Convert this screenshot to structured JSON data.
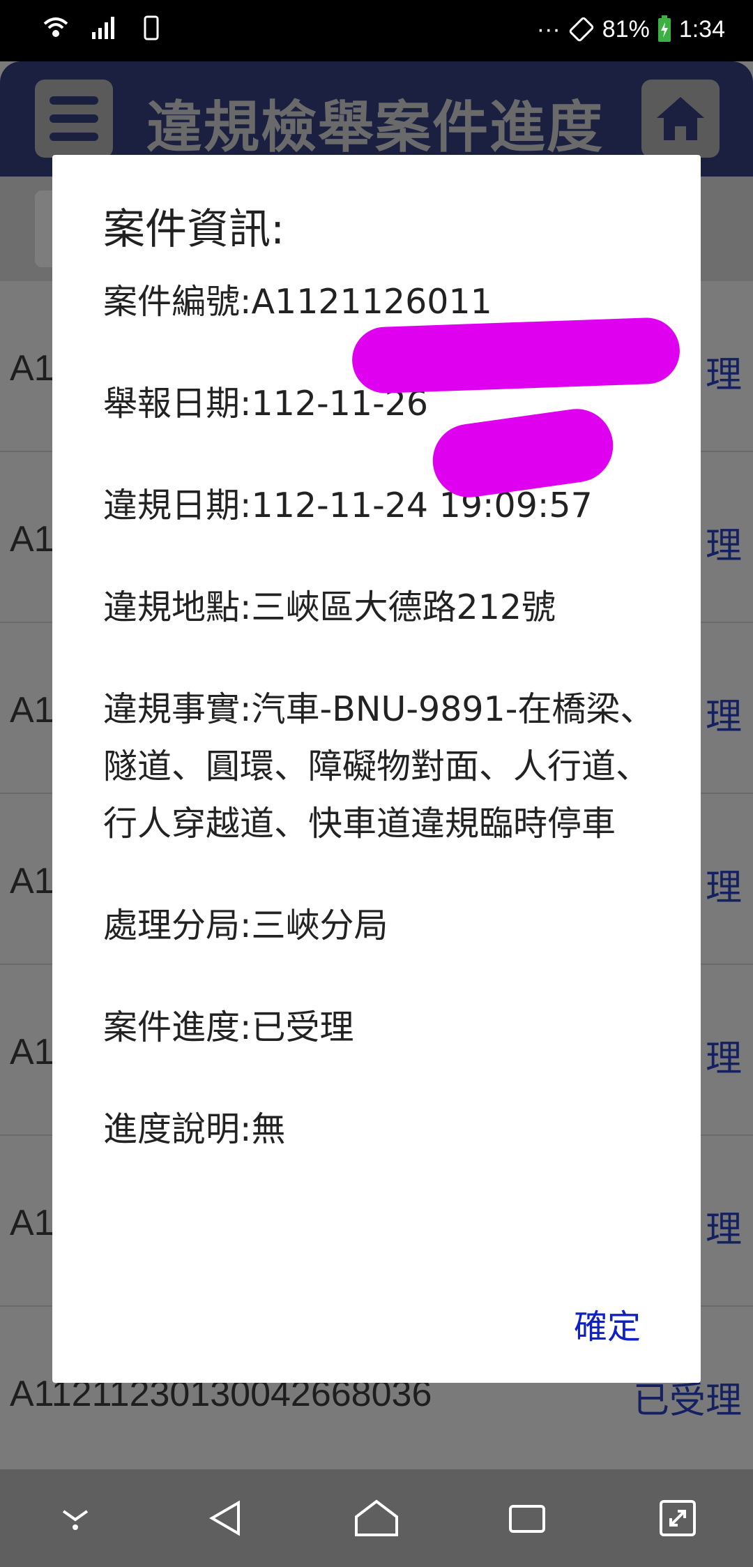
{
  "status_bar": {
    "battery": "81%",
    "time": "1:34",
    "more": "···"
  },
  "app": {
    "title": "違規檢舉案件進度"
  },
  "list": {
    "rows": [
      {
        "id": "A1",
        "status": "理"
      },
      {
        "id": "A1",
        "status": "理"
      },
      {
        "id": "A1",
        "status": "理"
      },
      {
        "id": "A1",
        "status": "理"
      },
      {
        "id": "A1",
        "status": "理"
      },
      {
        "id": "A1",
        "status": "理"
      },
      {
        "id": "A11211230130042668036",
        "status": "已受理"
      }
    ]
  },
  "dialog": {
    "title": "案件資訊:",
    "fields": [
      {
        "label": "案件編號:",
        "value": "A1121126011"
      },
      {
        "label": "舉報日期:",
        "value": "112-11-26"
      },
      {
        "label": "違規日期:",
        "value": "112-11-24 19:09:57"
      },
      {
        "label": "違規地點:",
        "value": "三峽區大德路212號"
      },
      {
        "label": "違規事實:",
        "value": "汽車-BNU-9891-在橋梁、隧道、圓環、障礙物對面、人行道、行人穿越道、快車道違規臨時停車"
      },
      {
        "label": "處理分局:",
        "value": "三峽分局"
      },
      {
        "label": "案件進度:",
        "value": "已受理"
      },
      {
        "label": "進度說明:",
        "value": "無"
      }
    ],
    "ok_label": "確定"
  },
  "nav": [
    "chevron-down-icon",
    "back-icon",
    "home-icon",
    "recents-icon",
    "expand-icon"
  ],
  "colors": {
    "accent": "#1020c8",
    "redaction": "#e000f0",
    "header": "#1b2040"
  }
}
